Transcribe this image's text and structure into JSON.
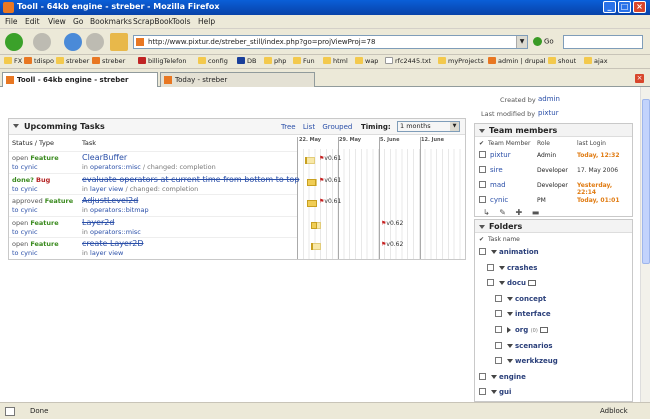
{
  "window": {
    "title": "Tooll - 64kb engine - streber - Mozilla Firefox"
  },
  "menu": [
    "File",
    "Edit",
    "View",
    "Go",
    "Bookmarks",
    "ScrapBook",
    "Tools",
    "Help"
  ],
  "nav": {
    "url": "http://www.pixtur.de/streber_still/index.php?go=projViewProj=78",
    "go_label": "Go"
  },
  "bookmarks": [
    {
      "label": "FX",
      "icon": "folder"
    },
    {
      "label": "tdispo",
      "icon": "streber"
    },
    {
      "label": "streber",
      "icon": "folder"
    },
    {
      "label": "streber",
      "icon": "streber"
    },
    {
      "label": "billigTelefon",
      "icon": "red"
    },
    {
      "label": "config",
      "icon": "folder"
    },
    {
      "label": "DB",
      "icon": "blue"
    },
    {
      "label": "php",
      "icon": "folder"
    },
    {
      "label": "Fun",
      "icon": "folder"
    },
    {
      "label": "html",
      "icon": "folder"
    },
    {
      "label": "wap",
      "icon": "folder"
    },
    {
      "label": "rfc2445.txt",
      "icon": "page"
    },
    {
      "label": "myProjects",
      "icon": "folder"
    },
    {
      "label": "admin | drupal",
      "icon": "streber"
    },
    {
      "label": "shout",
      "icon": "folder"
    },
    {
      "label": "ajax",
      "icon": "folder"
    }
  ],
  "tabs": [
    {
      "label": "Tooll - 64kb engine - streber",
      "active": true
    },
    {
      "label": "Today - streber",
      "active": false
    }
  ],
  "tasks_panel": {
    "title": "Upcomming Tasks",
    "views": [
      "Tree",
      "List",
      "Grouped"
    ],
    "timing_label": "Timing:",
    "timing_value": "1 months",
    "col_status": "Status / Type",
    "col_task": "Task",
    "gantt_weeks": [
      "22. May",
      "29. May",
      "5. June",
      "12. June"
    ],
    "rows": [
      {
        "state": "open",
        "type": "Feature",
        "assigned_prefix": "to",
        "assignee": "cynic",
        "title": "ClearBuffer",
        "strike": false,
        "sub_prefix": "in",
        "sub_link": "operators::misc",
        "sub_rest": "/ changed: completion",
        "milestone": "v0.61",
        "progress": 0.1
      },
      {
        "state": "done?",
        "type": "Bug",
        "assigned_prefix": "to",
        "assignee": "cynic",
        "title": "evaluate operators at current time from bottom to top",
        "strike": true,
        "sub_prefix": "in",
        "sub_link": "layer view",
        "sub_rest": "/ changed: completion",
        "milestone": "v0.61",
        "progress": 0.9
      },
      {
        "state": "approved",
        "type": "Feature",
        "assigned_prefix": "to",
        "assignee": "cynic",
        "title": "AdjustLevel2d",
        "strike": true,
        "sub_prefix": "in",
        "sub_link": "operators::bitmap",
        "sub_rest": "",
        "milestone": "v0.61",
        "progress": 1.0
      },
      {
        "state": "open",
        "type": "Feature",
        "assigned_prefix": "to",
        "assignee": "cynic",
        "title": "Layer2d",
        "strike": true,
        "sub_prefix": "in",
        "sub_link": "operators::misc",
        "sub_rest": "",
        "milestone": "v0.62",
        "progress": 0.6
      },
      {
        "state": "open",
        "type": "Feature",
        "assigned_prefix": "to",
        "assignee": "cynic",
        "title": "create Layer2D",
        "strike": true,
        "sub_prefix": "in",
        "sub_link": "layer view",
        "sub_rest": "",
        "milestone": "v0.62",
        "progress": 0.0
      }
    ]
  },
  "sidebar": {
    "created_by_label": "Created by",
    "created_by": "admin",
    "modified_by_label": "Last modified by",
    "modified_by": "pixtur",
    "team": {
      "title": "Team members",
      "cols": [
        "Team Member",
        "Role",
        "last Login"
      ],
      "members": [
        {
          "name": "pixtur",
          "role": "Admin",
          "login": "Today, 12:32",
          "hot": true
        },
        {
          "name": "sire",
          "role": "Developer",
          "login": "17. May 2006",
          "hot": false
        },
        {
          "name": "mad",
          "role": "Developer",
          "login": "Yesterday, 22:14",
          "hot": true
        },
        {
          "name": "cynic",
          "role": "PM",
          "login": "Today, 01:01",
          "hot": true
        }
      ]
    },
    "folders": {
      "title": "Folders",
      "col": "Task name",
      "items": [
        {
          "name": "animation",
          "depth": 0,
          "open": true
        },
        {
          "name": "crashes",
          "depth": 1,
          "open": true
        },
        {
          "name": "docu",
          "depth": 1,
          "open": true,
          "icon": true
        },
        {
          "name": "concept",
          "depth": 2,
          "open": true
        },
        {
          "name": "interface",
          "depth": 2,
          "open": true
        },
        {
          "name": "org",
          "depth": 2,
          "open": false,
          "count": "(0)",
          "icon": true
        },
        {
          "name": "scenarios",
          "depth": 2,
          "open": true
        },
        {
          "name": "werkkzeug",
          "depth": 2,
          "open": true
        },
        {
          "name": "engine",
          "depth": 0,
          "open": true
        },
        {
          "name": "gui",
          "depth": 0,
          "open": true
        }
      ]
    }
  },
  "status": {
    "text": "Done",
    "adblock": "Adblock"
  },
  "colors": {
    "title_bar": "#0842a8",
    "link": "#2a4fa8",
    "feature": "#3a8a1e",
    "bug": "#b42020",
    "hot_login": "#e07a10",
    "gantt_bar": "#f0cd55"
  }
}
